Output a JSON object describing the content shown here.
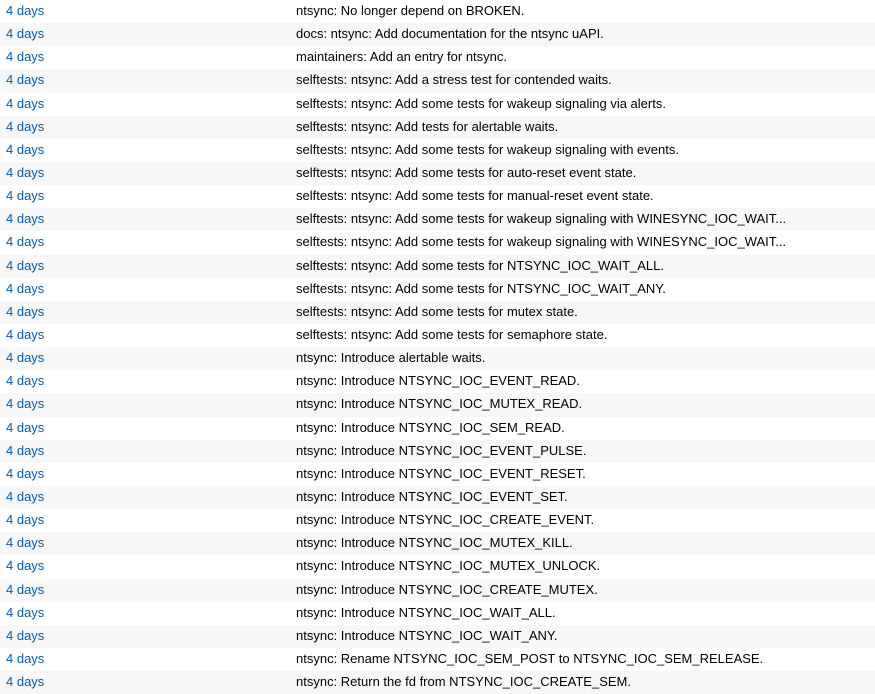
{
  "age_label": "4 days",
  "commits": [
    {
      "msg": "ntsync: No longer depend on BROKEN."
    },
    {
      "msg": "docs: ntsync: Add documentation for the ntsync uAPI."
    },
    {
      "msg": "maintainers: Add an entry for ntsync."
    },
    {
      "msg": "selftests: ntsync: Add a stress test for contended waits."
    },
    {
      "msg": "selftests: ntsync: Add some tests for wakeup signaling via alerts."
    },
    {
      "msg": "selftests: ntsync: Add tests for alertable waits."
    },
    {
      "msg": "selftests: ntsync: Add some tests for wakeup signaling with events."
    },
    {
      "msg": "selftests: ntsync: Add some tests for auto-reset event state."
    },
    {
      "msg": "selftests: ntsync: Add some tests for manual-reset event state."
    },
    {
      "msg": "selftests: ntsync: Add some tests for wakeup signaling with WINESYNC_IOC_WAIT..."
    },
    {
      "msg": "selftests: ntsync: Add some tests for wakeup signaling with WINESYNC_IOC_WAIT..."
    },
    {
      "msg": "selftests: ntsync: Add some tests for NTSYNC_IOC_WAIT_ALL."
    },
    {
      "msg": "selftests: ntsync: Add some tests for NTSYNC_IOC_WAIT_ANY."
    },
    {
      "msg": "selftests: ntsync: Add some tests for mutex state."
    },
    {
      "msg": "selftests: ntsync: Add some tests for semaphore state."
    },
    {
      "msg": "ntsync: Introduce alertable waits."
    },
    {
      "msg": "ntsync: Introduce NTSYNC_IOC_EVENT_READ."
    },
    {
      "msg": "ntsync: Introduce NTSYNC_IOC_MUTEX_READ."
    },
    {
      "msg": "ntsync: Introduce NTSYNC_IOC_SEM_READ."
    },
    {
      "msg": "ntsync: Introduce NTSYNC_IOC_EVENT_PULSE."
    },
    {
      "msg": "ntsync: Introduce NTSYNC_IOC_EVENT_RESET."
    },
    {
      "msg": "ntsync: Introduce NTSYNC_IOC_EVENT_SET."
    },
    {
      "msg": "ntsync: Introduce NTSYNC_IOC_CREATE_EVENT."
    },
    {
      "msg": "ntsync: Introduce NTSYNC_IOC_MUTEX_KILL."
    },
    {
      "msg": "ntsync: Introduce NTSYNC_IOC_MUTEX_UNLOCK."
    },
    {
      "msg": "ntsync: Introduce NTSYNC_IOC_CREATE_MUTEX."
    },
    {
      "msg": "ntsync: Introduce NTSYNC_IOC_WAIT_ALL."
    },
    {
      "msg": "ntsync: Introduce NTSYNC_IOC_WAIT_ANY."
    },
    {
      "msg": "ntsync: Rename NTSYNC_IOC_SEM_POST to NTSYNC_IOC_SEM_RELEASE."
    },
    {
      "msg": "ntsync: Return the fd from NTSYNC_IOC_CREATE_SEM."
    }
  ]
}
